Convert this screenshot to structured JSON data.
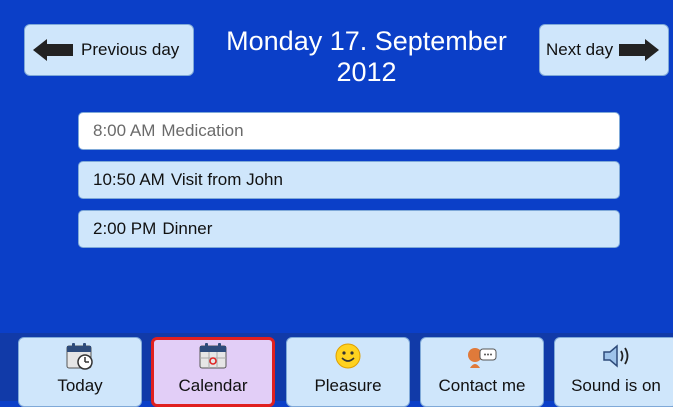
{
  "header": {
    "prev_label": "Previous day",
    "next_label": "Next day",
    "date_line1": "Monday 17. September",
    "date_line2": "2012"
  },
  "events": [
    {
      "time": "8:00 AM",
      "title": "Medication",
      "state": "past"
    },
    {
      "time": "10:50 AM",
      "title": "Visit from John",
      "state": "upcoming"
    },
    {
      "time": "2:00 PM",
      "title": "Dinner",
      "state": "upcoming"
    }
  ],
  "toolbar": {
    "today_label": "Today",
    "calendar_label": "Calendar",
    "pleasure_label": "Pleasure",
    "contact_label": "Contact me",
    "sound_label": "Sound is on",
    "active": "calendar"
  },
  "colors": {
    "background": "#0b3fc8",
    "button": "#cfe6fb",
    "active_tab": "#e2cef7",
    "active_border": "#e02020"
  }
}
